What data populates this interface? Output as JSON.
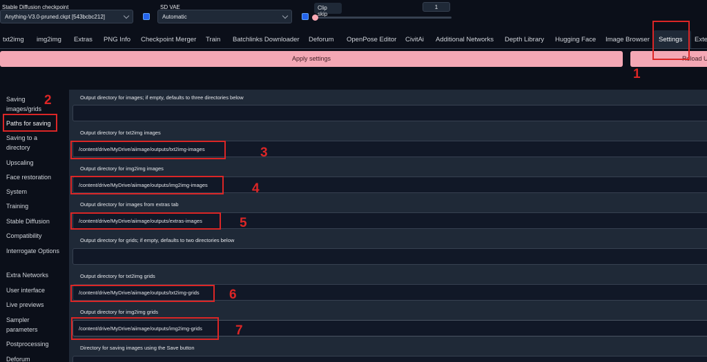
{
  "top_controls": {
    "checkpoint_label": "Stable Diffusion checkpoint",
    "checkpoint_value": "Anything-V3.0-pruned.ckpt [543bcbc212]",
    "vae_label": "SD VAE",
    "vae_value": "Automatic",
    "clip_skip_label": "Clip skip",
    "clip_skip_value": "1",
    "clip_skip_slider_fraction": 0
  },
  "tabs": [
    {
      "label": "txt2img"
    },
    {
      "label": "img2img"
    },
    {
      "label": "Extras"
    },
    {
      "label": "PNG Info"
    },
    {
      "label": "Checkpoint Merger"
    },
    {
      "label": "Train"
    },
    {
      "label": "Batchlinks Downloader"
    },
    {
      "label": "Deforum"
    },
    {
      "label": "OpenPose Editor"
    },
    {
      "label": "CivitAi"
    },
    {
      "label": "Additional Networks"
    },
    {
      "label": "Depth Library"
    },
    {
      "label": "Hugging Face"
    },
    {
      "label": "Image Browser"
    },
    {
      "label": "Settings"
    },
    {
      "label": "Exter"
    }
  ],
  "buttons": {
    "apply": "Apply settings",
    "reload": "Reload UI"
  },
  "sidebar": [
    {
      "label": "Saving images/grids"
    },
    {
      "label": "Paths for saving"
    },
    {
      "label": "Saving to a directory"
    },
    {
      "label": "Upscaling"
    },
    {
      "label": "Face restoration"
    },
    {
      "label": "System"
    },
    {
      "label": "Training"
    },
    {
      "label": "Stable Diffusion"
    },
    {
      "label": "Compatibility"
    },
    {
      "label": "Interrogate Options"
    },
    {
      "label": "Extra Networks"
    },
    {
      "label": "User interface"
    },
    {
      "label": "Live previews"
    },
    {
      "label": "Sampler parameters"
    },
    {
      "label": "Postprocessing"
    },
    {
      "label": "Deforum"
    }
  ],
  "fields": [
    {
      "label": "Output directory for images; if empty, defaults to three directories below",
      "value": ""
    },
    {
      "label": "Output directory for txt2img images",
      "value": "/content/drive/MyDrive/aiimage/outputs/txt2img-images"
    },
    {
      "label": "Output directory for img2img images",
      "value": "/content/drive/MyDrive/aiimage/outputs/img2img-images"
    },
    {
      "label": "Output directory for images from extras tab",
      "value": "/content/drive/MyDrive/aiimage/outputs/extras-images"
    },
    {
      "label": "Output directory for grids; if empty, defaults to two directories below",
      "value": ""
    },
    {
      "label": "Output directory for txt2img grids",
      "value": "/content/drive/MyDrive/aiimage/outputs/txt2img-grids"
    },
    {
      "label": "Output directory for img2img grids",
      "value": "/content/drive/MyDrive/aiimage/outputs/img2img-grids"
    },
    {
      "label": "Directory for saving images using the Save button",
      "value": ""
    }
  ],
  "annotations": [
    "1",
    "2",
    "3",
    "4",
    "5",
    "6",
    "7"
  ],
  "colors": {
    "background": "#0b0f19",
    "panel": "#1f2937",
    "input": "#111827",
    "accent_button": "#f4a8b5",
    "annotation_red": "#dc2626",
    "refresh_blue": "#2563eb"
  }
}
